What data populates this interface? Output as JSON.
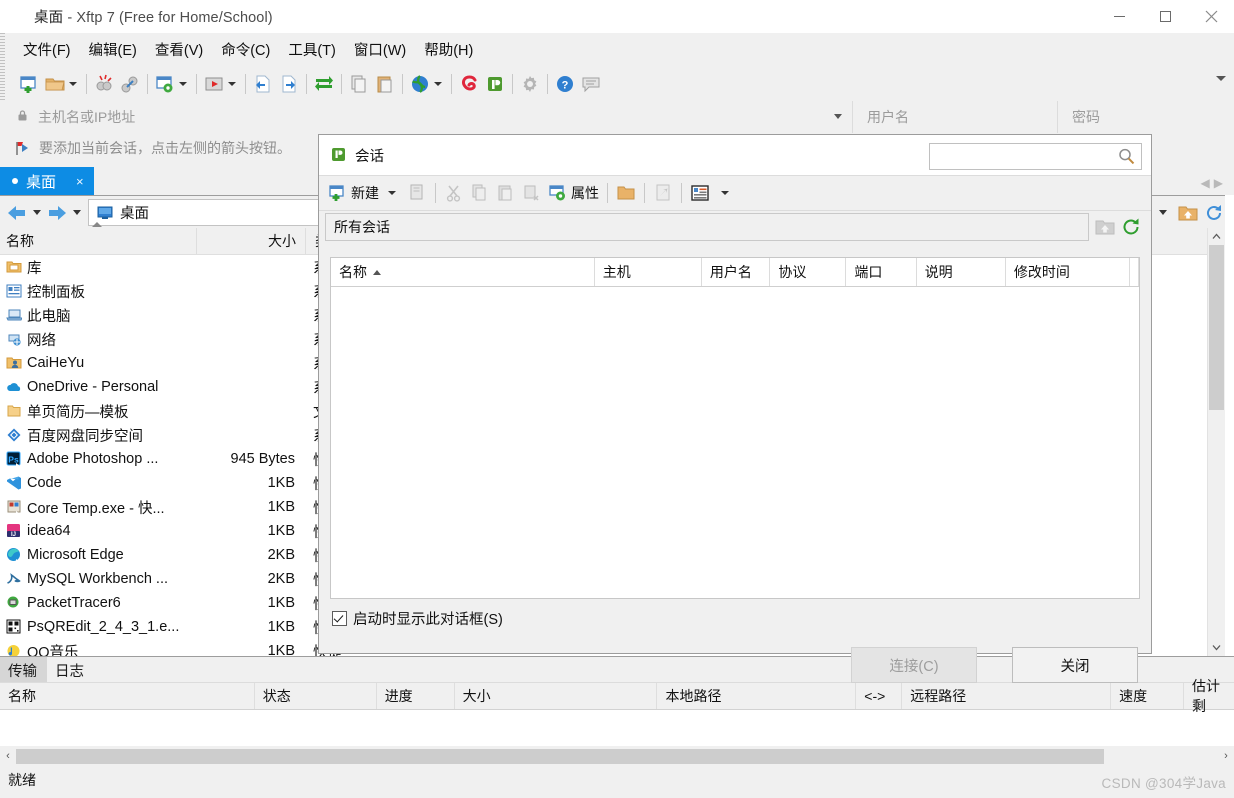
{
  "window": {
    "title_prefix": "桌面",
    "title_suffix": " - Xftp 7 (Free for Home/School)",
    "app_icon": "xftp-icon",
    "minimize": "—",
    "maximize": "▢",
    "close": "✕"
  },
  "menubar": {
    "items": [
      {
        "label": "文件(F)",
        "name": "menu-file"
      },
      {
        "label": "编辑(E)",
        "name": "menu-edit"
      },
      {
        "label": "查看(V)",
        "name": "menu-view"
      },
      {
        "label": "命令(C)",
        "name": "menu-command"
      },
      {
        "label": "工具(T)",
        "name": "menu-tools"
      },
      {
        "label": "窗口(W)",
        "name": "menu-window"
      },
      {
        "label": "帮助(H)",
        "name": "menu-help"
      }
    ]
  },
  "toolbar": {
    "icons": [
      "new-session-icon",
      "open-folder-icon",
      "disconnect-icon",
      "link-icon",
      "session-properties-icon",
      "run-icon",
      "transfer-left-icon",
      "transfer-right-icon",
      "sync-icon",
      "copy-icon",
      "paste-icon",
      "globe-icon",
      "xshell-icon",
      "xftp-icon",
      "settings-gear-icon",
      "help-icon",
      "feedback-icon"
    ],
    "overflow": "toolbar-overflow-chevron"
  },
  "connectbar": {
    "host_placeholder": "主机名或IP地址",
    "user_placeholder": "用户名",
    "password_placeholder": "密码",
    "lock_icon": "lock-icon",
    "dropdown_icon": "chevron-down-icon"
  },
  "hintbar": {
    "icon": "red-flag-icon",
    "text": "要添加当前会话，点击左侧的箭头按钮。"
  },
  "tabs": {
    "active_color": "#0d8ce4",
    "items": [
      {
        "label": "桌面",
        "close": "×",
        "name": "tab-desktop"
      }
    ],
    "nav_left": "◀",
    "nav_right": "▶"
  },
  "navbar": {
    "back_icon": "arrow-back-icon",
    "forward_icon": "arrow-forward-icon",
    "path_icon": "desktop-icon",
    "path_value": "桌面",
    "up_icon": "folder-up-icon",
    "refresh_icon": "refresh-icon",
    "dropdown_icon": "chevron-down-icon"
  },
  "filelist": {
    "columns": [
      "名称",
      "大小",
      "类型"
    ],
    "sort_indicator": "sort-asc-icon",
    "rows": [
      {
        "icon": "library-folder-icon",
        "name": "库",
        "size": "",
        "type": "系统"
      },
      {
        "icon": "control-panel-icon",
        "name": "控制面板",
        "size": "",
        "type": "系统"
      },
      {
        "icon": "this-pc-icon",
        "name": "此电脑",
        "size": "",
        "type": "系统"
      },
      {
        "icon": "network-icon",
        "name": "网络",
        "size": "",
        "type": "系统"
      },
      {
        "icon": "user-folder-icon",
        "name": "CaiHeYu",
        "size": "",
        "type": "系统"
      },
      {
        "icon": "onedrive-icon",
        "name": "OneDrive - Personal",
        "size": "",
        "type": "系统"
      },
      {
        "icon": "folder-icon",
        "name": "单页简历—模板",
        "size": "",
        "type": "文件"
      },
      {
        "icon": "baidu-netdisk-icon",
        "name": "百度网盘同步空间",
        "size": "",
        "type": "系统"
      },
      {
        "icon": "photoshop-icon",
        "name": "Adobe Photoshop ...",
        "size": "945 Bytes",
        "type": "快捷"
      },
      {
        "icon": "vscode-icon",
        "name": "Code",
        "size": "1KB",
        "type": "快捷"
      },
      {
        "icon": "core-temp-icon",
        "name": "Core Temp.exe - 快...",
        "size": "1KB",
        "type": "快捷"
      },
      {
        "icon": "intellij-icon",
        "name": "idea64",
        "size": "1KB",
        "type": "快捷"
      },
      {
        "icon": "edge-icon",
        "name": "Microsoft Edge",
        "size": "2KB",
        "type": "快捷"
      },
      {
        "icon": "mysql-workbench-icon",
        "name": "MySQL Workbench ...",
        "size": "2KB",
        "type": "快捷"
      },
      {
        "icon": "packet-tracer-icon",
        "name": "PacketTracer6",
        "size": "1KB",
        "type": "快捷"
      },
      {
        "icon": "qrcode-icon",
        "name": "PsQREdit_2_4_3_1.e...",
        "size": "1KB",
        "type": "快捷"
      },
      {
        "icon": "qqmusic-icon",
        "name": "QQ音乐",
        "size": "1KB",
        "type": "快捷"
      }
    ]
  },
  "bottom_panel": {
    "tabs": [
      {
        "label": "传输",
        "active": true,
        "name": "tab-transfer"
      },
      {
        "label": "日志",
        "active": false,
        "name": "tab-log"
      }
    ],
    "columns": [
      "名称",
      "状态",
      "进度",
      "大小",
      "本地路径",
      "<->",
      "远程路径",
      "速度",
      "估计剩"
    ],
    "rows": [],
    "status": "就绪",
    "watermark": "CSDN @304学Java"
  },
  "dialog": {
    "icon": "xftp-icon",
    "title": "会话",
    "close": "✕",
    "toolbar": {
      "new_label": "新建",
      "new_icon": "new-session-icon",
      "new_dropdown": "chevron-down-icon",
      "open_icon": "open-session-icon",
      "cut_icon": "cut-icon",
      "copy_icon": "copy-icon",
      "paste_icon": "paste-icon",
      "delete_icon": "delete-icon",
      "properties_icon": "properties-icon",
      "properties_label": "属性",
      "folder_icon": "folder-icon",
      "shortcut_icon": "shortcut-icon",
      "view_icon": "view-list-icon",
      "view_dropdown": "chevron-down-icon",
      "search_placeholder": "",
      "search_icon": "search-icon"
    },
    "path": {
      "value": "所有会话",
      "up_icon": "folder-up-icon",
      "refresh_icon": "refresh-icon"
    },
    "list": {
      "columns": [
        "名称",
        "主机",
        "用户名",
        "协议",
        "端口",
        "说明",
        "修改时间"
      ],
      "sort_column": "名称",
      "sort_dir": "asc",
      "rows": []
    },
    "footer": {
      "checkbox_label": "启动时显示此对话框(S)",
      "checkbox_checked": true,
      "connect_label": "连接(C)",
      "connect_disabled": true,
      "close_label": "关闭"
    }
  }
}
